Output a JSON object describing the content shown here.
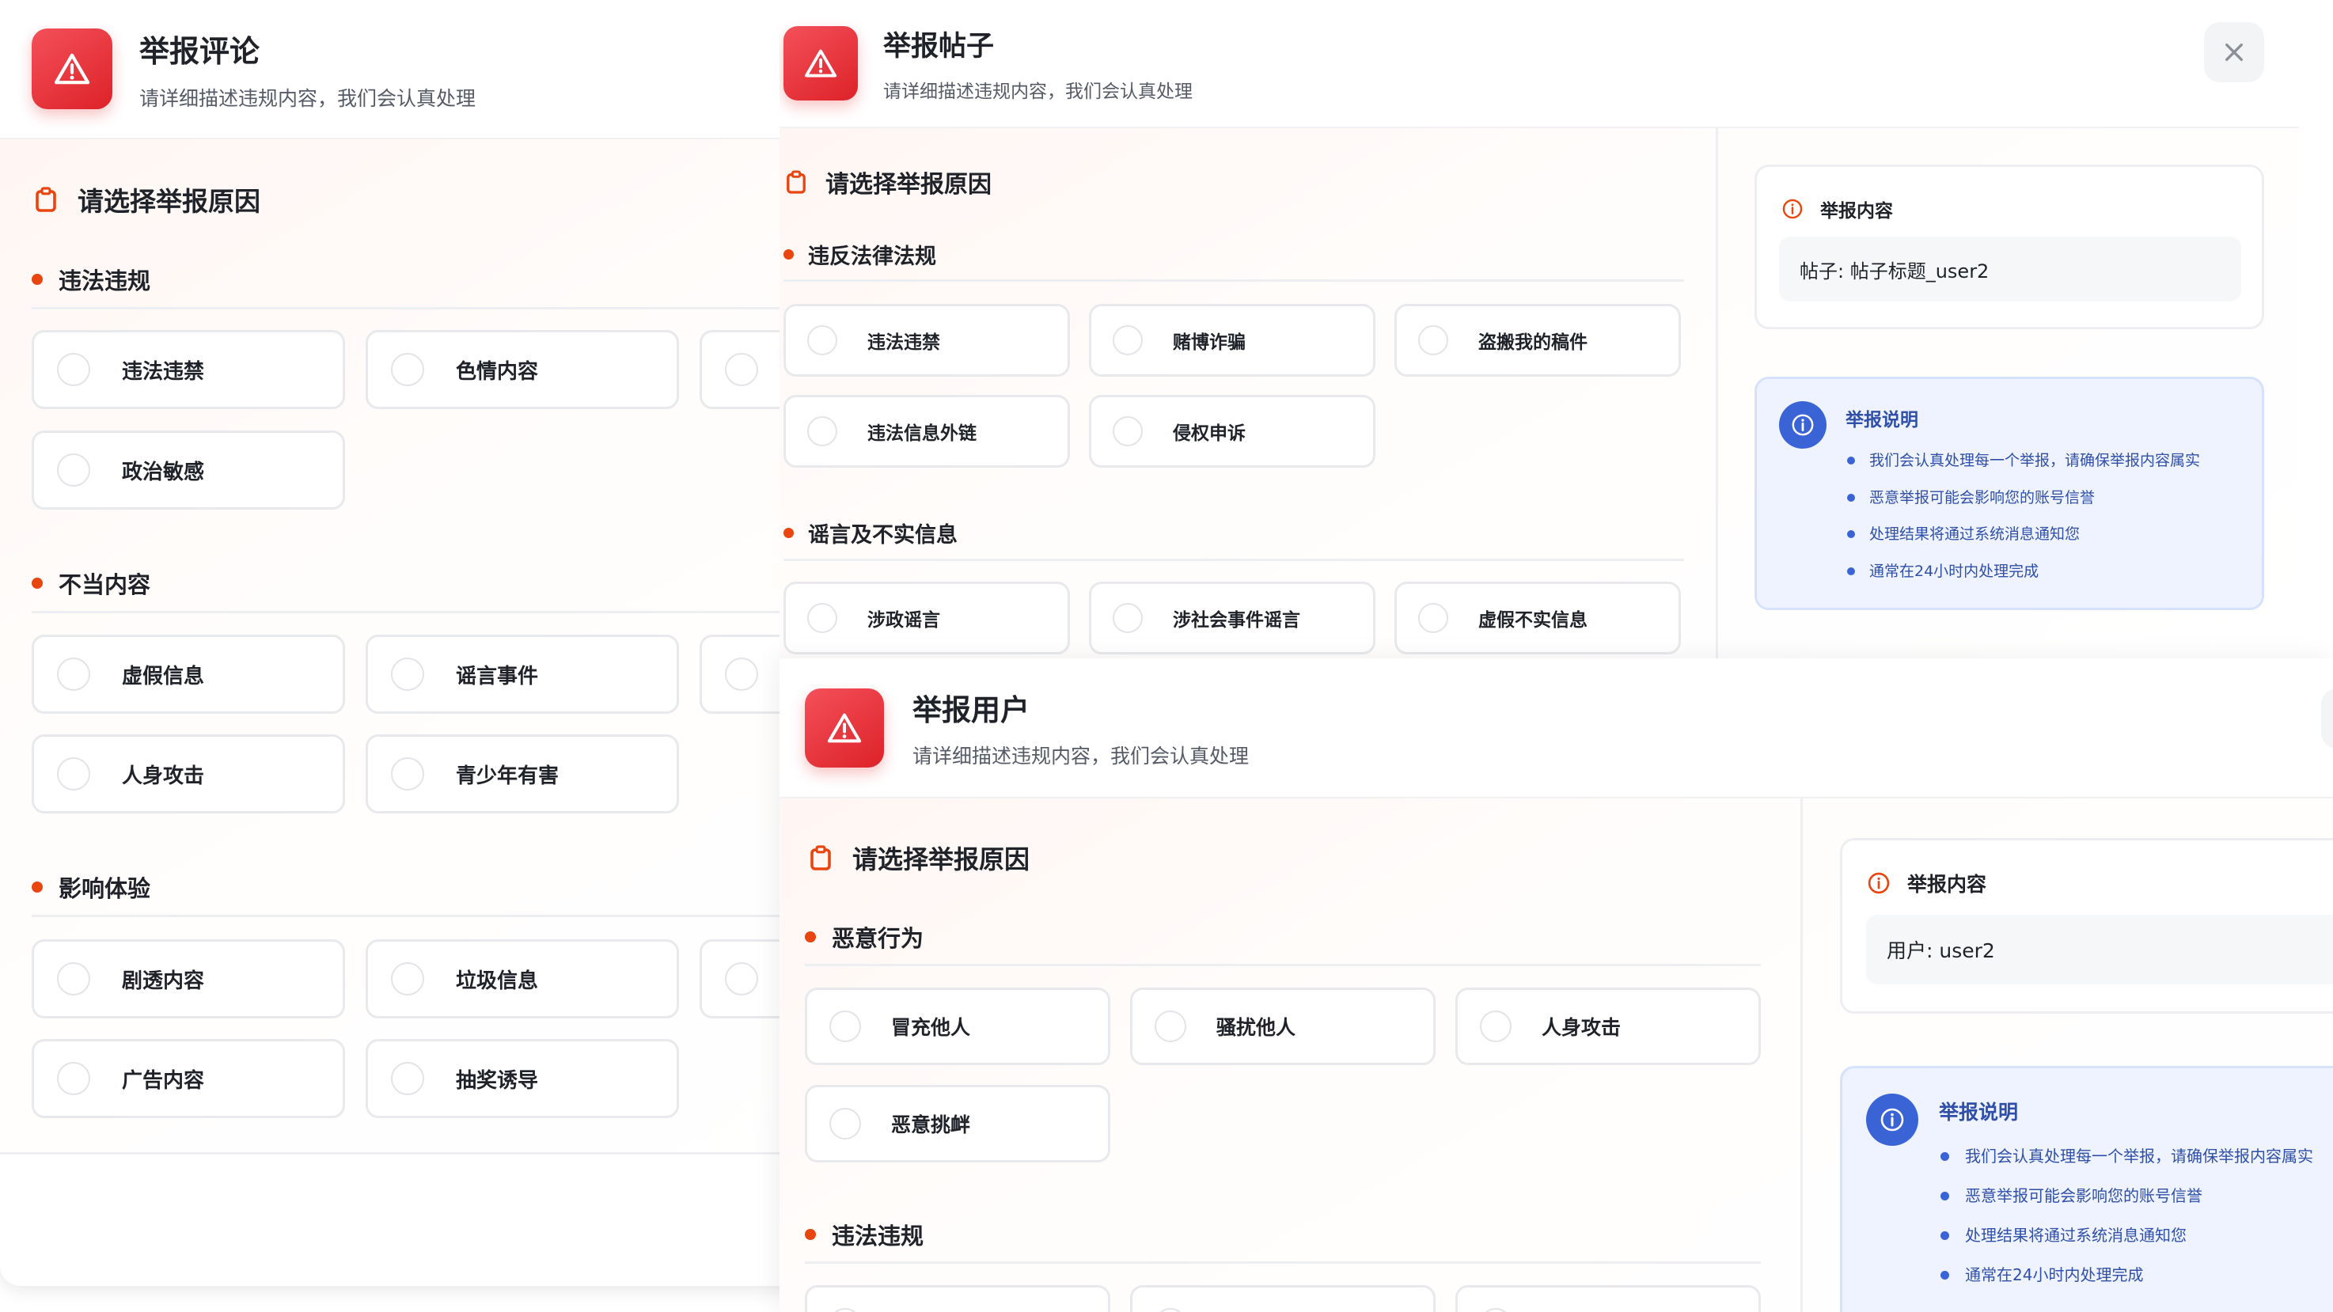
{
  "common": {
    "subtitle": "请详细描述违规内容，我们会认真处理",
    "section_title": "请选择举报原因"
  },
  "comment": {
    "title": "举报评论",
    "categories": [
      {
        "name": "违法违规",
        "options": [
          "违法违禁",
          "色情内容",
          "",
          "政治敏感"
        ]
      },
      {
        "name": "不当内容",
        "options": [
          "虚假信息",
          "谣言事件",
          "",
          "人身攻击",
          "青少年有害"
        ]
      },
      {
        "name": "影响体验",
        "options": [
          "剧透内容",
          "垃圾信息",
          "",
          "广告内容",
          "抽奖诱导"
        ]
      }
    ]
  },
  "post": {
    "title": "举报帖子",
    "categories": [
      {
        "name": "违反法律法规",
        "options": [
          "违法违禁",
          "赌博诈骗",
          "盗搬我的稿件",
          "违法信息外链",
          "侵权申诉"
        ]
      },
      {
        "name": "谣言及不实信息",
        "options": [
          "涉政谣言",
          "涉社会事件谣言",
          "虚假不实信息"
        ]
      }
    ],
    "content_card": {
      "title": "举报内容",
      "value": "帖子: 帖子标题_user2"
    },
    "notice": {
      "title": "举报说明",
      "items": [
        "我们会认真处理每一个举报，请确保举报内容属实",
        "恶意举报可能会影响您的账号信誉",
        "处理结果将通过系统消息通知您",
        "通常在24小时内处理完成"
      ]
    }
  },
  "user": {
    "title": "举报用户",
    "categories": [
      {
        "name": "恶意行为",
        "options": [
          "冒充他人",
          "骚扰他人",
          "人身攻击",
          "恶意挑衅"
        ]
      },
      {
        "name": "违法违规",
        "options": [
          "",
          "",
          ""
        ]
      }
    ],
    "content_card": {
      "title": "举报内容",
      "value": "用户: user2"
    },
    "notice": {
      "title": "举报说明",
      "items": [
        "我们会认真处理每一个举报，请确保举报内容属实",
        "恶意举报可能会影响您的账号信誉",
        "处理结果将通过系统消息通知您",
        "通常在24小时内处理完成"
      ]
    }
  },
  "colors": {
    "accent": "#e8450f",
    "danger": "#e52d2d",
    "info_blue": "#3a63d6"
  },
  "icons": [
    "warning-triangle-icon",
    "clipboard-icon",
    "close-icon",
    "info-circle-icon"
  ]
}
